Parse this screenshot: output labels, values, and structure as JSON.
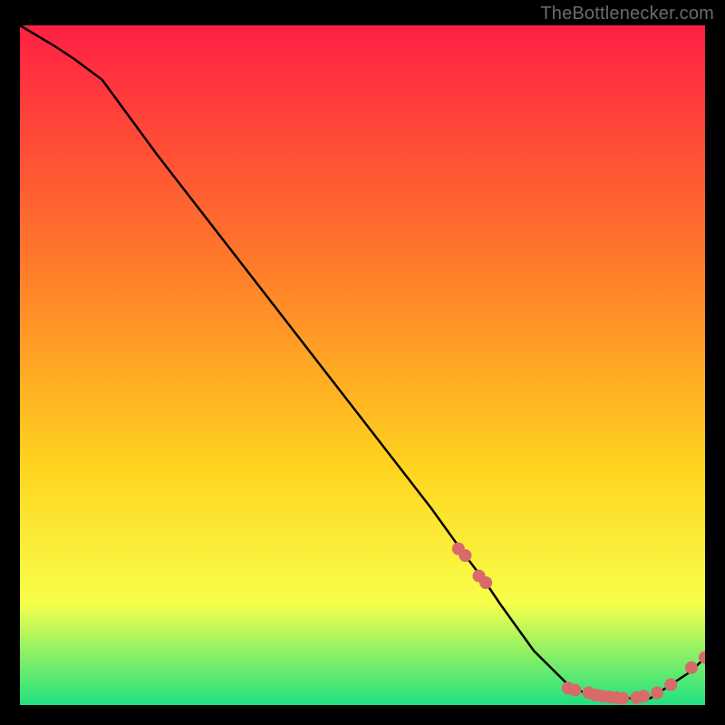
{
  "watermark": "TheBottlenecker.com",
  "colors": {
    "gradient_top": "#ff1f44",
    "gradient_mid_a": "#ff7a2a",
    "gradient_mid_b": "#ffd41f",
    "gradient_mid_c": "#f7ff4a",
    "gradient_bottom": "#1fe081",
    "line": "#000000",
    "marker": "#d86a6a",
    "frame": "#000000",
    "text": "#6b6b6b"
  },
  "chart_data": {
    "type": "line",
    "title": "",
    "xlabel": "",
    "ylabel": "",
    "xlim": [
      0,
      100
    ],
    "ylim": [
      0,
      100
    ],
    "series": [
      {
        "name": "bottleneck-curve",
        "x": [
          0,
          5,
          8,
          12,
          20,
          30,
          40,
          50,
          60,
          65,
          68,
          70,
          75,
          80,
          82,
          85,
          88,
          90,
          92,
          95,
          98,
          100
        ],
        "values": [
          100,
          97,
          95,
          92,
          81,
          68,
          55,
          42,
          29,
          22,
          18,
          15,
          8,
          3,
          2,
          1,
          1,
          1,
          1,
          3,
          5,
          7
        ]
      }
    ],
    "markers": [
      {
        "x": 64,
        "y": 23
      },
      {
        "x": 65,
        "y": 22
      },
      {
        "x": 67,
        "y": 19
      },
      {
        "x": 68,
        "y": 18
      },
      {
        "x": 80,
        "y": 2.5
      },
      {
        "x": 81,
        "y": 2.2
      },
      {
        "x": 83,
        "y": 1.8
      },
      {
        "x": 84,
        "y": 1.5
      },
      {
        "x": 85,
        "y": 1.3
      },
      {
        "x": 86,
        "y": 1.2
      },
      {
        "x": 87,
        "y": 1.1
      },
      {
        "x": 88,
        "y": 1.0
      },
      {
        "x": 90,
        "y": 1.1
      },
      {
        "x": 91,
        "y": 1.3
      },
      {
        "x": 93,
        "y": 1.8
      },
      {
        "x": 95,
        "y": 3.0
      },
      {
        "x": 98,
        "y": 5.5
      },
      {
        "x": 100,
        "y": 7.0
      }
    ]
  }
}
